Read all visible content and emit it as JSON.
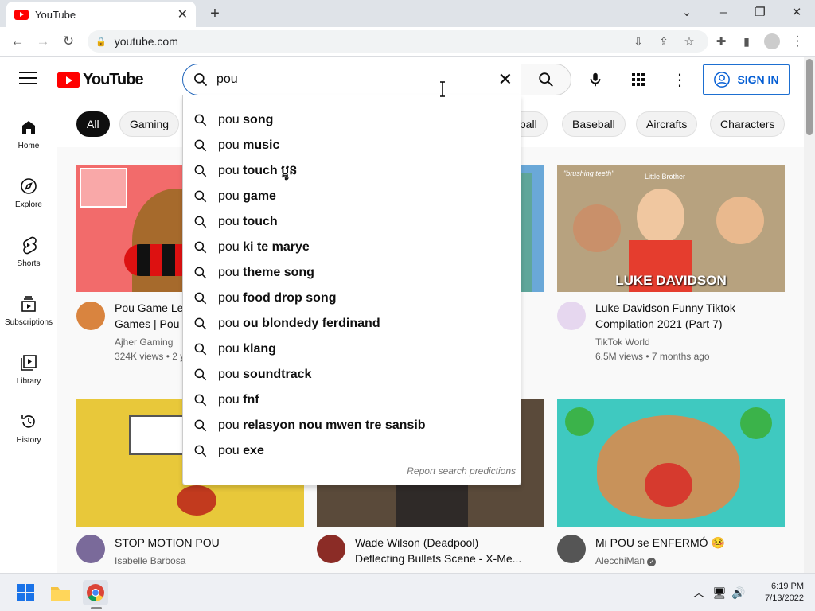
{
  "browser": {
    "tab_title": "YouTube",
    "url": "youtube.com",
    "new_tab": "+",
    "window_controls": [
      "⌄",
      "–",
      "❐",
      "✕"
    ]
  },
  "youtube": {
    "logo_text": "YouTube",
    "search_query": "pou",
    "sign_in": "SIGN IN",
    "sidebar": [
      {
        "label": "Home",
        "icon": "home-icon"
      },
      {
        "label": "Explore",
        "icon": "compass-icon"
      },
      {
        "label": "Shorts",
        "icon": "shorts-icon"
      },
      {
        "label": "Subscriptions",
        "icon": "subscriptions-icon"
      },
      {
        "label": "Library",
        "icon": "library-icon"
      },
      {
        "label": "History",
        "icon": "history-icon"
      }
    ],
    "chips": [
      "All",
      "Gaming",
      "tball",
      "Baseball",
      "Aircrafts",
      "Characters"
    ],
    "suggestions": [
      {
        "prefix": "pou",
        "rest": "song"
      },
      {
        "prefix": "pou",
        "rest": "music"
      },
      {
        "prefix": "pou",
        "rest": "touch ប្អូន"
      },
      {
        "prefix": "pou",
        "rest": "game"
      },
      {
        "prefix": "pou",
        "rest": "touch"
      },
      {
        "prefix": "pou",
        "rest": "ki te marye"
      },
      {
        "prefix": "pou",
        "rest": "theme song"
      },
      {
        "prefix": "pou",
        "rest": "food drop song"
      },
      {
        "prefix": "pou",
        "rest": "ou blondedy ferdinand"
      },
      {
        "prefix": "pou",
        "rest": "klang"
      },
      {
        "prefix": "pou",
        "rest": "soundtrack"
      },
      {
        "prefix": "pou",
        "rest": "fnf"
      },
      {
        "prefix": "pou",
        "rest": "relasyon nou mwen tre sansib"
      },
      {
        "prefix": "pou",
        "rest": "exe"
      }
    ],
    "report_predictions": "Report search predictions",
    "videos": [
      {
        "title": "Pou Game Le\nGames | Pou",
        "channel": "Ajher Gaming",
        "stats": "324K views • 2 y",
        "thumb_color": "#f26b6b"
      },
      {
        "title": "",
        "channel": "",
        "stats": "",
        "thumb_color": "#6aa8d8"
      },
      {
        "title": "Luke Davidson Funny Tiktok\nCompilation 2021 (Part 7)",
        "channel": "TikTok World",
        "stats": "6.5M views • 7 months ago",
        "thumb_color": "#b7a27f",
        "thumb_caption": "LUKE DAVIDSON",
        "thumb_tag1": "\"brushing teeth\"",
        "thumb_tag2": "Little Brother"
      },
      {
        "title": "STOP MOTION POU",
        "channel": "Isabelle Barbosa",
        "stats": "",
        "thumb_color": "#e8c83a"
      },
      {
        "title": "Wade Wilson (Deadpool)\nDeflecting Bullets Scene - X-Me...",
        "channel": "",
        "stats": "",
        "thumb_color": "#5a4a3a"
      },
      {
        "title": "Mi POU se ENFERMÓ 🤒",
        "channel": "AlecchiMan",
        "stats": "",
        "thumb_color": "#3fc9c0"
      }
    ]
  },
  "taskbar": {
    "time": "6:19 PM",
    "date": "7/13/2022"
  }
}
